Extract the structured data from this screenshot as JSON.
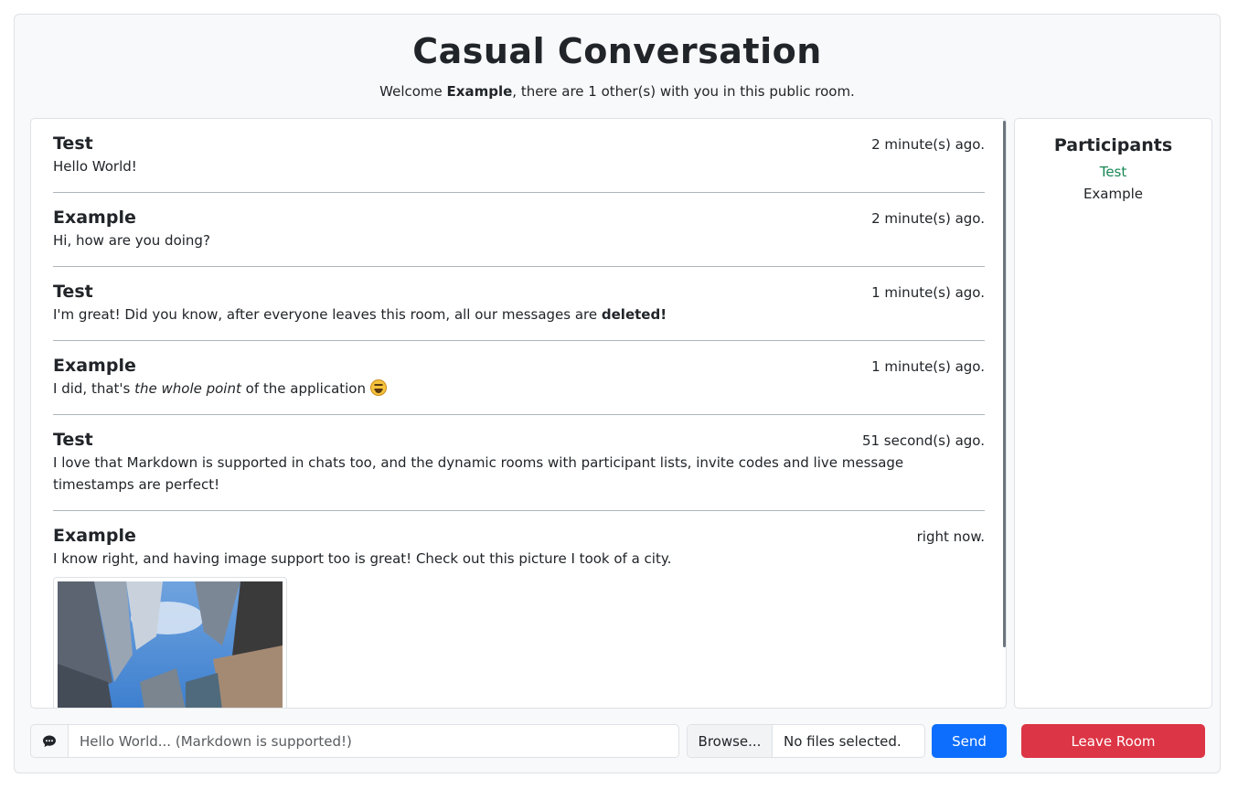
{
  "room": {
    "title": "Casual Conversation",
    "welcome_prefix": "Welcome ",
    "username": "Example",
    "welcome_suffix": ", there are 1 other(s) with you in this public room."
  },
  "messages": [
    {
      "author": "Test",
      "time": "2 minute(s) ago.",
      "text": "Hello World!"
    },
    {
      "author": "Example",
      "time": "2 minute(s) ago.",
      "text": "Hi, how are you doing?"
    },
    {
      "author": "Test",
      "time": "1 minute(s) ago.",
      "text_prefix": "I'm great! Did you know, after everyone leaves this room, all our messages are ",
      "text_bold": "deleted!"
    },
    {
      "author": "Example",
      "time": "1 minute(s) ago.",
      "text_prefix": "I did, that's ",
      "text_italic": "the whole point",
      "text_suffix": " of the application ",
      "emoji": "grinning-squinting-face"
    },
    {
      "author": "Test",
      "time": "51 second(s) ago.",
      "text": "I love that Markdown is supported in chats too, and the dynamic rooms with participant lists, invite codes and live message timestamps are perfect!"
    },
    {
      "author": "Example",
      "time": "right now.",
      "text": "I know right, and having image support too is great! Check out this picture I took of a city.",
      "image": "city-skyscrapers-photo"
    }
  ],
  "participants": {
    "heading": "Participants",
    "list": [
      "Test",
      "Example"
    ]
  },
  "composer": {
    "icon": "chat-bubble-icon",
    "placeholder": "Hello World... (Markdown is supported!)",
    "browse_label": "Browse...",
    "file_status": "No files selected.",
    "send_label": "Send",
    "leave_label": "Leave Room"
  },
  "colors": {
    "send": "#0d6efd",
    "leave": "#dc3545",
    "self_participant": "#198754"
  }
}
